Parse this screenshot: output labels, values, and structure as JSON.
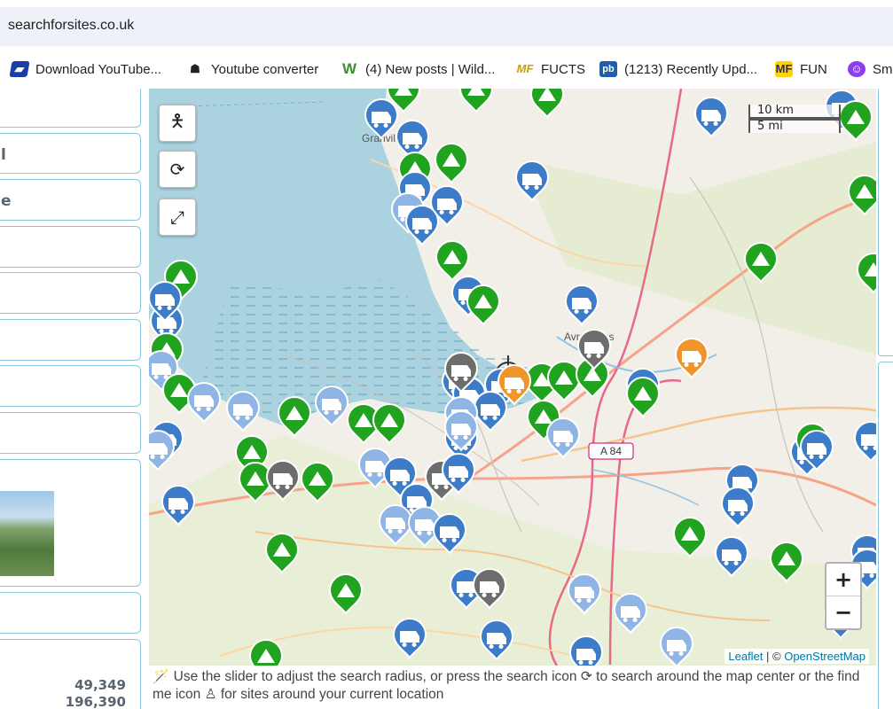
{
  "browser": {
    "url": "searchforsites.co.uk"
  },
  "bookmarks": [
    {
      "label": "Download YouTube...",
      "icon": "video-download-icon",
      "color": "#1a3ea8"
    },
    {
      "label": "Youtube converter",
      "icon": "fox-icon",
      "color": "#222222"
    },
    {
      "label": "(4) New posts | Wild...",
      "icon": "w-logo-icon",
      "color": "#3c8f2f"
    },
    {
      "label": "FUCTS",
      "icon": "mf-logo-icon",
      "color": "#c9a000"
    },
    {
      "label": "(1213) Recently Upd...",
      "icon": "pb-logo-icon",
      "color": "#1e5fa8"
    },
    {
      "label": "FUN",
      "icon": "mf-logo-icon",
      "color": "#2a2a7a"
    },
    {
      "label": "Sma",
      "icon": "twitch-icon",
      "color": "#8a3ff0"
    }
  ],
  "sidebar": {
    "items": [
      "",
      "l",
      "e",
      "",
      "",
      "",
      "",
      ""
    ],
    "stats": [
      "49,349",
      "196,390"
    ]
  },
  "map": {
    "scale": {
      "km": "10 km",
      "mi": "5 mi"
    },
    "place_labels": [
      "Granville",
      "Avranches"
    ],
    "road_label": "A 84",
    "zoom_in": "+",
    "zoom_out": "−",
    "attribution": {
      "leaflet": "Leaflet",
      "sep": " | © ",
      "osm": "OpenStreetMap"
    },
    "colors": {
      "sea": "#aad3df",
      "land": "#f2efe9",
      "green_marker": "#22a31f",
      "blue_marker": "#3d7cc9",
      "grey_marker": "#6d6d6d",
      "orange_marker": "#f0952a",
      "light_blue_marker": "#8fb5e6",
      "light_green_marker": "#7cc04a"
    }
  },
  "hint": {
    "part1": "Use the slider to adjust the search radius, or press the search icon",
    "part2": "to search around the map center or the find me icon",
    "part3": "for sites around your current location"
  }
}
